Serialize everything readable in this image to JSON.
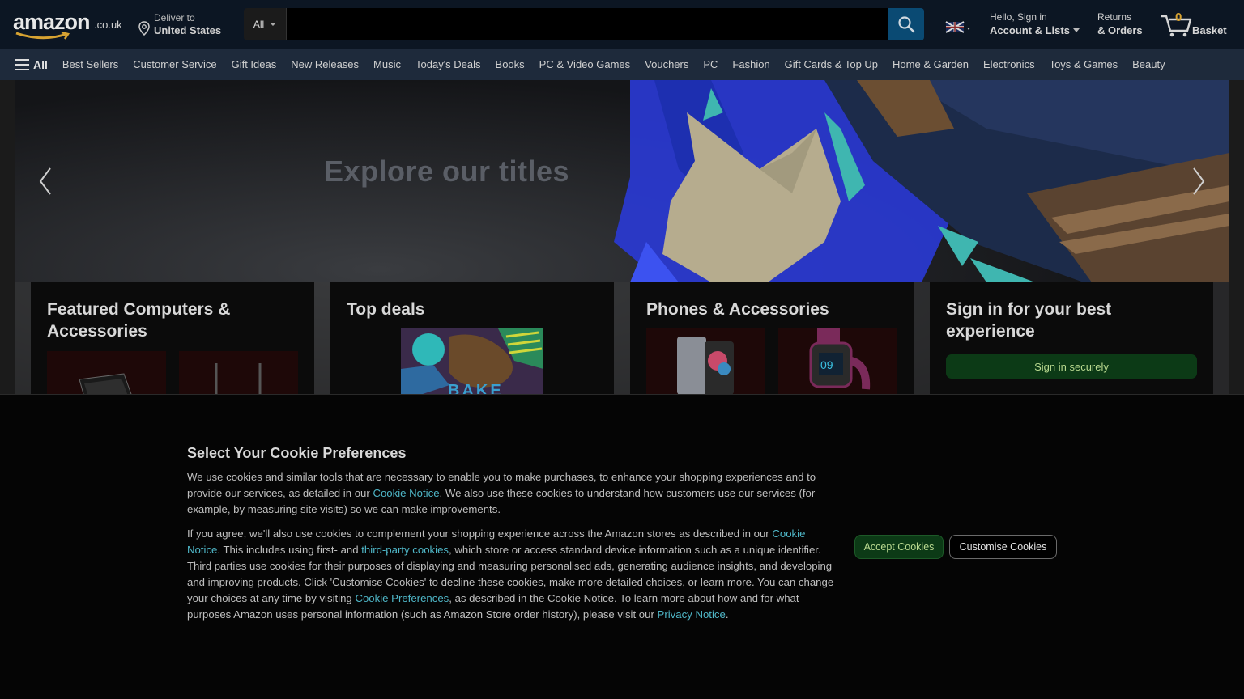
{
  "header": {
    "logo_text": "amazon",
    "logo_tld": ".co.uk",
    "deliver_line1": "Deliver to",
    "deliver_line2": "United States",
    "search_category": "All",
    "search_placeholder": "",
    "account_line1": "Hello, Sign in",
    "account_line2": "Account & Lists",
    "returns_line1": "Returns",
    "returns_line2": "& Orders",
    "basket_count": "0",
    "basket_label": "Basket"
  },
  "nav": {
    "all_label": "All",
    "items": [
      "Best Sellers",
      "Customer Service",
      "Gift Ideas",
      "New Releases",
      "Music",
      "Today's Deals",
      "Books",
      "PC & Video Games",
      "Vouchers",
      "PC",
      "Fashion",
      "Gift Cards & Top Up",
      "Home & Garden",
      "Electronics",
      "Toys & Games",
      "Beauty"
    ]
  },
  "hero": {
    "title": "Explore our titles"
  },
  "cards": {
    "computers_title": "Featured Computers & Accessories",
    "deals_title": "Top deals",
    "phones_title": "Phones & Accessories",
    "signin_title": "Sign in for your best experience",
    "signin_button": "Sign in securely",
    "deals_book_text": "BAKE"
  },
  "cookie": {
    "title": "Select Your Cookie Preferences",
    "p1_a": "We use cookies and similar tools that are necessary to enable you to make purchases, to enhance your shopping experiences and to provide our services, as detailed in our ",
    "p1_link": "Cookie Notice",
    "p1_b": ". We also use these cookies to understand how customers use our services (for example, by measuring site visits) so we can make improvements.",
    "p2_a": "If you agree, we'll also use cookies to complement your shopping experience across the Amazon stores as described in our ",
    "p2_link1": "Cookie Notice",
    "p2_b": ". This includes using first- and ",
    "p2_link2": "third-party cookies",
    "p2_c": ", which store or access standard device information such as a unique identifier. Third parties use cookies for their purposes of displaying and measuring personalised ads, generating audience insights, and developing and improving products. Click 'Customise Cookies' to decline these cookies, make more detailed choices, or learn more. You can change your choices at any time by visiting ",
    "p2_link3": "Cookie Preferences",
    "p2_d": ", as described in the Cookie Notice. To learn more about how and for what purposes Amazon uses personal information (such as Amazon Store order history), please visit our ",
    "p2_link4": "Privacy Notice",
    "p2_e": ".",
    "accept_label": "Accept Cookies",
    "customise_label": "Customise Cookies"
  },
  "colors": {
    "header_bg": "#0c1623",
    "nav_bg": "#1e2a3b",
    "search_button": "#0a4a73",
    "accent_link": "#4fb7c8",
    "accept_bg": "#0c3a16",
    "basket_count": "#d7a332"
  },
  "icons": [
    "pin-icon",
    "search-icon",
    "uk-flag-icon",
    "cart-icon",
    "hamburger-icon",
    "chevron-left-icon",
    "chevron-right-icon"
  ]
}
